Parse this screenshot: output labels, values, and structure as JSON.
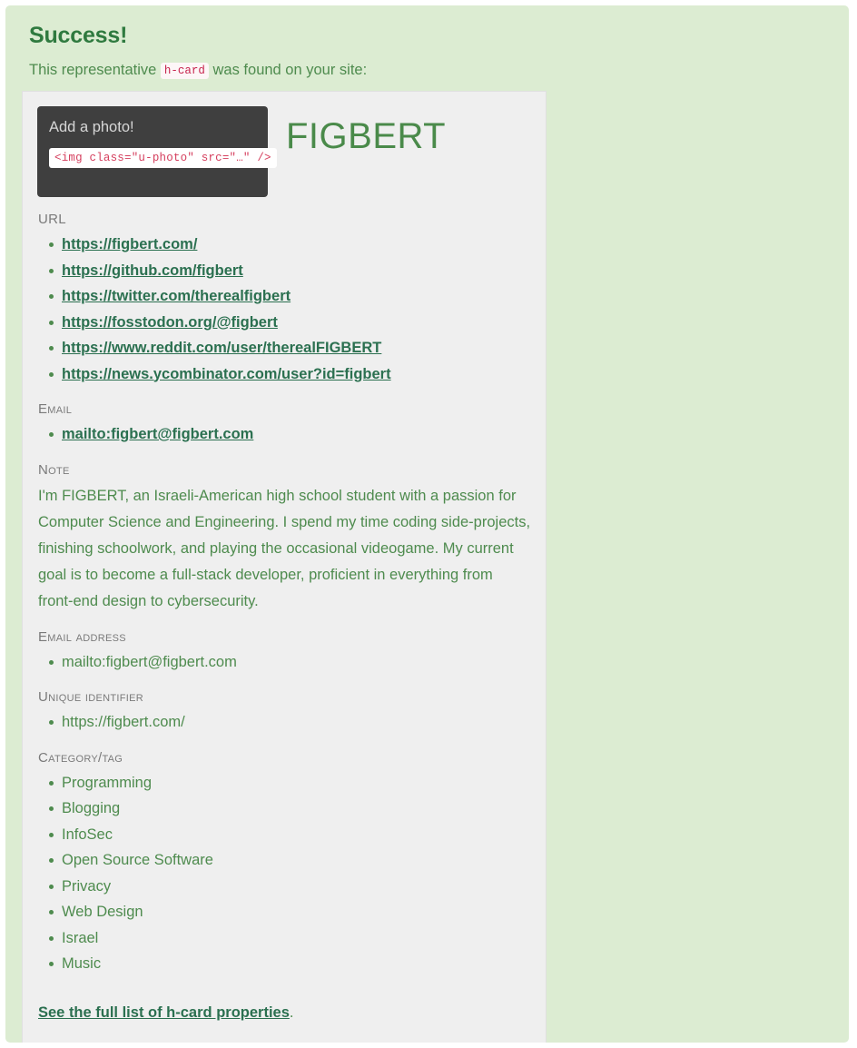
{
  "alert": {
    "heading": "Success!",
    "intro_before": "This representative ",
    "intro_code": "h-card",
    "intro_after": " was found on your site:",
    "background_color": "#dcecd2",
    "heading_color": "#2f7a3f"
  },
  "card": {
    "photo": {
      "prompt": "Add a photo!",
      "code_snippet": "<img class=\"u-photo\" src=\"…\" />",
      "background_color": "#3f3f3f",
      "code_color": "#d53f5e"
    },
    "name": "FIGBERT",
    "name_color": "#4a8a4a",
    "properties": [
      {
        "label": "URL",
        "is_link": true,
        "values": [
          "https://figbert.com/",
          "https://github.com/figbert",
          "https://twitter.com/therealfigbert",
          "https://fosstodon.org/@figbert",
          "https://www.reddit.com/user/therealFIGBERT",
          "https://news.ycombinator.com/user?id=figbert"
        ]
      },
      {
        "label": "Email",
        "is_link": true,
        "values": [
          "mailto:figbert@figbert.com"
        ]
      }
    ],
    "note": {
      "label": "Note",
      "text": "I'm FIGBERT, an Israeli-American high school student with a passion for Computer Science and Engineering. I spend my time coding side-projects, finishing schoolwork, and playing the occasional videogame. My current goal is to become a full-stack developer, proficient in everything from front-end design to cybersecurity."
    },
    "properties_plain": [
      {
        "label": "Email address",
        "is_link": false,
        "values": [
          "mailto:figbert@figbert.com"
        ]
      },
      {
        "label": "Unique identifier",
        "is_link": false,
        "values": [
          "https://figbert.com/"
        ]
      },
      {
        "label": "Category/tag",
        "is_link": false,
        "values": [
          "Programming",
          "Blogging",
          "InfoSec",
          "Open Source Software",
          "Privacy",
          "Web Design",
          "Israel",
          "Music"
        ]
      }
    ],
    "footer": {
      "link_text": "See the full list of h-card properties",
      "trailing_text": "."
    }
  }
}
